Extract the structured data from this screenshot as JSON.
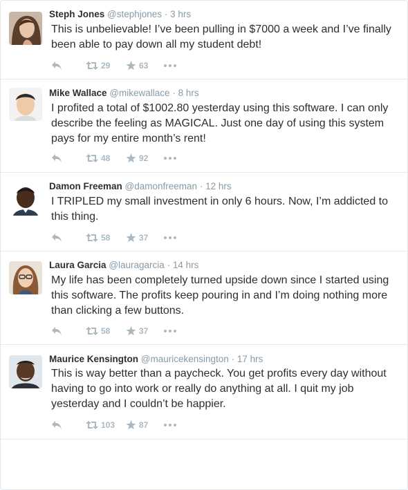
{
  "colors": {
    "name": "#292f33",
    "meta": "#8899a6",
    "action": "#aab8c2",
    "border": "#e1e8ed"
  },
  "tweets": [
    {
      "name": "Steph Jones",
      "handle": "@stephjones",
      "time": "3 hrs",
      "lines": [
        "This is unbelievable! I’ve been pulling in $7000 a week and I’ve finally",
        "been able to pay down all my student debt!"
      ],
      "retweets": "29",
      "likes": "63"
    },
    {
      "name": "Mike Wallace",
      "handle": "@mikewallace",
      "time": "8 hrs",
      "lines": [
        "I profited a total of $1002.80 yesterday using this software. I can only",
        "describe the feeling as MAGICAL. Just one day of  using this system",
        "pays for my entire month’s rent!"
      ],
      "retweets": "48",
      "likes": "92"
    },
    {
      "name": "Damon Freeman",
      "handle": "@damonfreeman",
      "time": "12 hrs",
      "lines": [
        "I TRIPLED my small investment in only 6 hours. Now, I’m addicted to",
        "this thing."
      ],
      "retweets": "58",
      "likes": "37"
    },
    {
      "name": "Laura Garcia",
      "handle": "@lauragarcia",
      "time": "14 hrs",
      "lines": [
        "My life has been completely turned upside down since I started using",
        "this software. The profits keep pouring in and I’m doing nothing more",
        "than clicking a few buttons."
      ],
      "retweets": "58",
      "likes": "37"
    },
    {
      "name": "Maurice Kensington",
      "handle": "@mauricekensington",
      "time": "17 hrs",
      "lines": [
        "This is way better than a paycheck. You get profits every day without",
        "having to go into work or really do anything at all. I quit my job",
        "yesterday and I couldn’t be happier."
      ],
      "retweets": "103",
      "likes": "87"
    }
  ],
  "meta_separator": "·"
}
